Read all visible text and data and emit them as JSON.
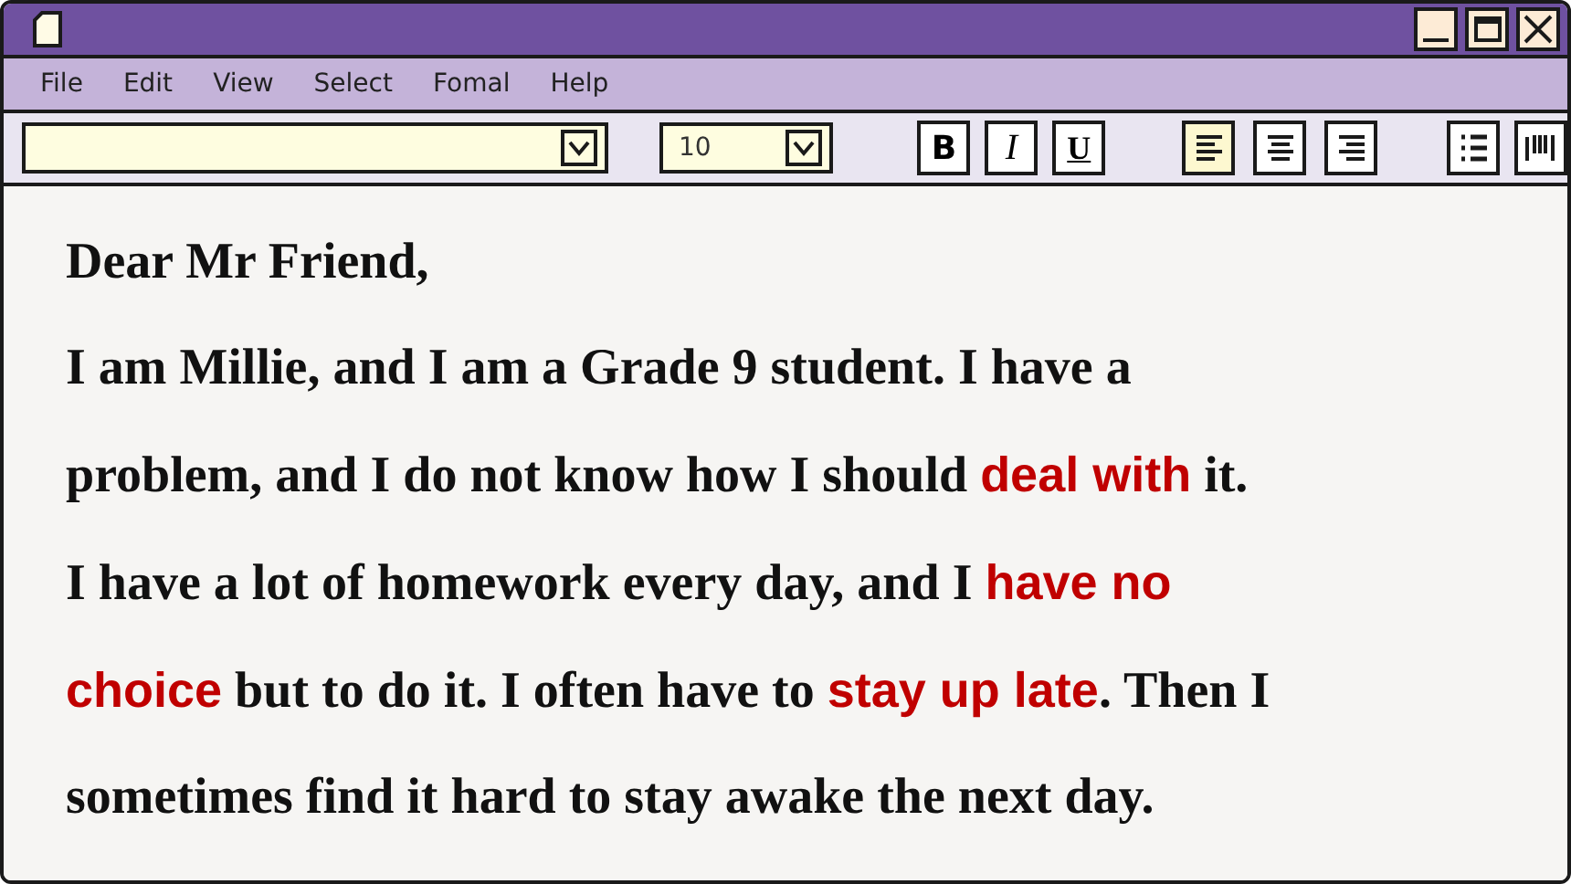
{
  "menu": [
    "File",
    "Edit",
    "View",
    "Select",
    "Fomal",
    "Help"
  ],
  "toolbar": {
    "size_field": {
      "value": "10"
    },
    "buttons": [
      {
        "kind": "bold",
        "label": "B",
        "selected": false
      },
      {
        "kind": "italic",
        "label": "I",
        "selected": false
      },
      {
        "kind": "underline",
        "label": "U",
        "selected": false
      },
      {
        "kind": "align-left",
        "selected": true
      },
      {
        "kind": "align-center",
        "selected": false
      },
      {
        "kind": "align-right",
        "selected": false
      },
      {
        "kind": "list",
        "selected": false
      },
      {
        "kind": "columns",
        "selected": false
      }
    ]
  },
  "document": {
    "lines": [
      [
        {
          "text": "Dear Mr Friend,",
          "highlight": false
        }
      ],
      [
        {
          "text": "I am Millie, and I am a Grade 9 student. I have a",
          "highlight": false
        }
      ],
      [
        {
          "text": "problem, and I do not know how I should ",
          "highlight": false
        },
        {
          "text": "deal with",
          "highlight": true
        },
        {
          "text": " it.",
          "highlight": false
        }
      ],
      [
        {
          "text": "I have a lot of homework every day, and I ",
          "highlight": false
        },
        {
          "text": "have no",
          "highlight": true
        }
      ],
      [
        {
          "text": "choice",
          "highlight": true
        },
        {
          "text": " but to do it. I often have to ",
          "highlight": false
        },
        {
          "text": "stay up late",
          "highlight": true
        },
        {
          "text": ". Then I",
          "highlight": false
        }
      ],
      [
        {
          "text": "sometimes find it hard to stay awake the next day.",
          "highlight": false
        }
      ]
    ]
  }
}
